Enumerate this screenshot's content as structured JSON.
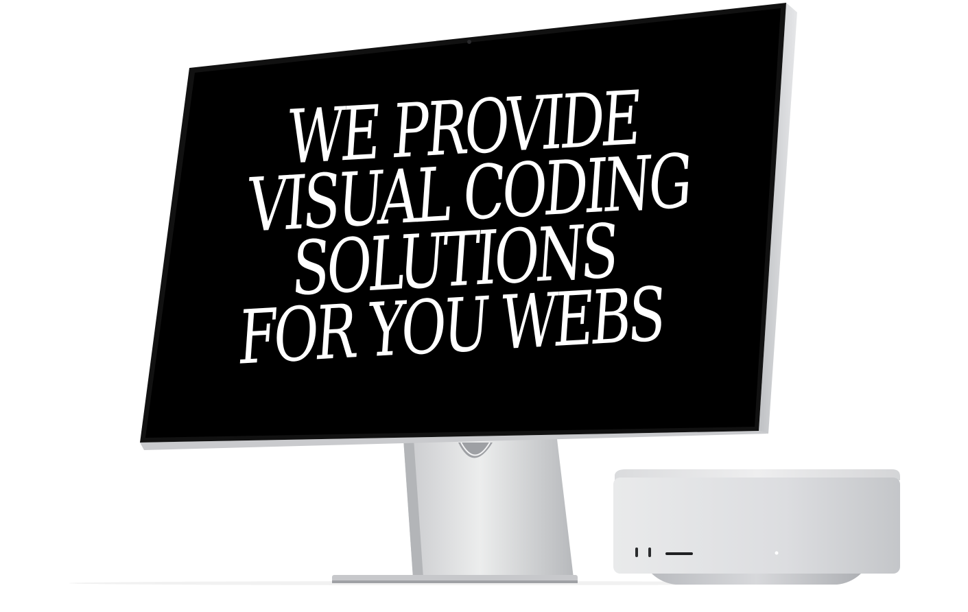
{
  "screen": {
    "headline_lines": [
      "WE PROVIDE",
      "VISUAL CODING",
      "SOLUTIONS",
      "FOR YOU WEBS"
    ],
    "text_color": "#ffffff",
    "background_color": "#000000"
  },
  "devices": {
    "display": "studio-display",
    "computer": "mac-studio"
  },
  "colors": {
    "page_background": "#ffffff",
    "aluminum_light": "#e4e5e7",
    "aluminum_dark": "#a7a9ad"
  }
}
